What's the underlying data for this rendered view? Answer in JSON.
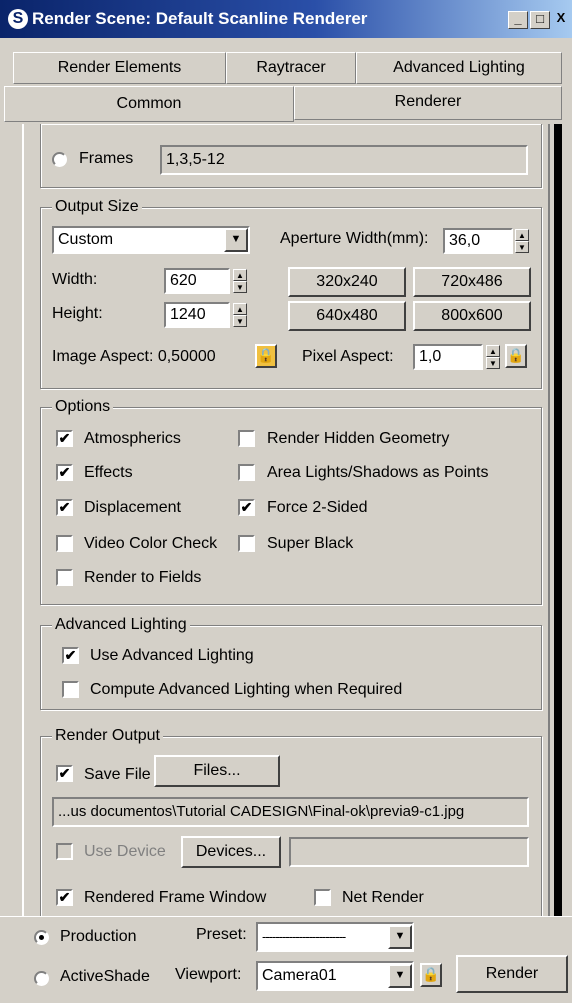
{
  "window": {
    "title": "Render Scene: Default Scanline Renderer",
    "icon": "3ds-max-app-icon",
    "controls": [
      "_",
      "□",
      "X"
    ]
  },
  "tabs": {
    "row1": [
      "Render Elements",
      "Raytracer",
      "Advanced Lighting"
    ],
    "row2": [
      "Common",
      "Renderer"
    ]
  },
  "frames": {
    "label": "Frames",
    "value": "1,3,5-12"
  },
  "output_size": {
    "legend": "Output Size",
    "preset": "Custom",
    "aperture_label": "Aperture Width(mm):",
    "aperture_value": "36,0",
    "width_label": "Width:",
    "width_value": "620",
    "height_label": "Height:",
    "height_value": "1240",
    "presets": [
      "320x240",
      "720x486",
      "640x480",
      "800x600"
    ],
    "image_aspect_label": "Image Aspect: 0,50000",
    "pixel_aspect_label": "Pixel Aspect:",
    "pixel_aspect_value": "1,0"
  },
  "options": {
    "legend": "Options",
    "items": [
      {
        "label": "Atmospherics",
        "checked": true
      },
      {
        "label": "Render Hidden Geometry",
        "checked": false
      },
      {
        "label": "Effects",
        "checked": true
      },
      {
        "label": "Area Lights/Shadows as Points",
        "checked": false
      },
      {
        "label": "Displacement",
        "checked": true
      },
      {
        "label": "Force 2-Sided",
        "checked": true
      },
      {
        "label": "Video Color Check",
        "checked": false
      },
      {
        "label": "Super Black",
        "checked": false
      },
      {
        "label": "Render to Fields",
        "checked": false
      }
    ]
  },
  "advanced_lighting": {
    "legend": "Advanced Lighting",
    "use": {
      "label": "Use Advanced Lighting",
      "checked": true
    },
    "compute": {
      "label": "Compute Advanced Lighting when Required",
      "checked": false
    }
  },
  "render_output": {
    "legend": "Render Output",
    "save_file": {
      "label": "Save File",
      "checked": true
    },
    "files_button": "Files...",
    "path": "...us documentos\\Tutorial CADESIGN\\Final-ok\\previa9-c1.jpg",
    "use_device": {
      "label": "Use Device",
      "checked": false
    },
    "devices_button": "Devices...",
    "rendered_frame_window": {
      "label": "Rendered Frame Window",
      "checked": true
    },
    "net_render": {
      "label": "Net Render",
      "checked": false
    }
  },
  "bottom": {
    "production_label": "Production",
    "activeshade_label": "ActiveShade",
    "preset_label": "Preset:",
    "preset_value": "-------------------------",
    "viewport_label": "Viewport:",
    "viewport_value": "Camera01",
    "render_button": "Render"
  },
  "check_mark": "✔",
  "arrows": {
    "down": "▼",
    "up": "▲"
  }
}
